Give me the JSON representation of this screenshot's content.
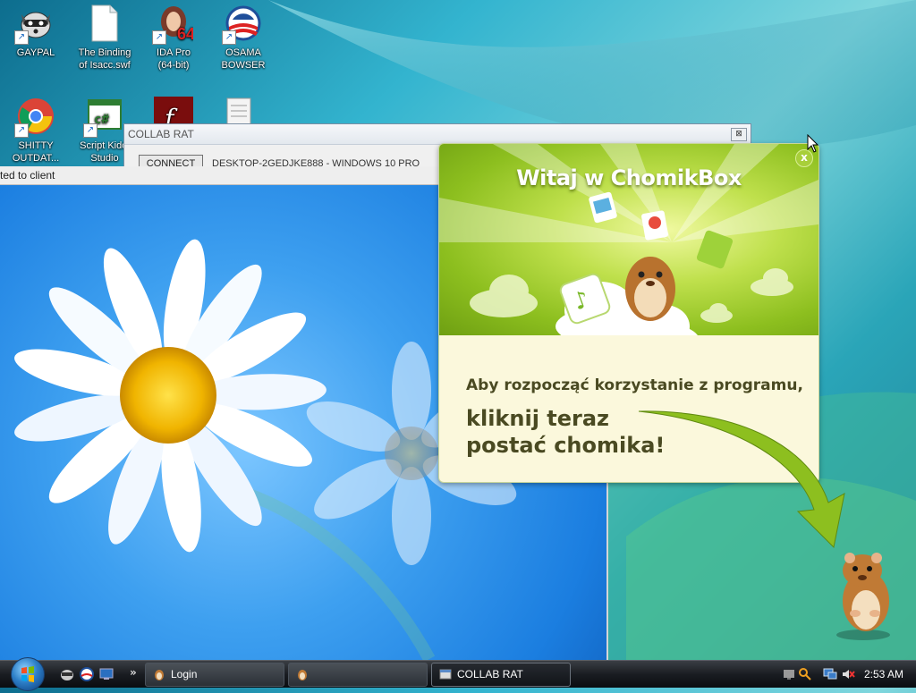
{
  "desktop": {
    "icons": [
      {
        "label_line1": "GAYPAL",
        "label_line2": "",
        "icon": "raccoon-icon"
      },
      {
        "label_line1": "The Binding",
        "label_line2": "of Isacc.swf",
        "icon": "blank-file-icon"
      },
      {
        "label_line1": "IDA Pro",
        "label_line2": "(64-bit)",
        "icon": "ida-pro-icon"
      },
      {
        "label_line1": "OSAMA",
        "label_line2": "BOWSER",
        "icon": "campaign-logo-icon"
      },
      {
        "label_line1": "SHITTY",
        "label_line2": "OUTDAT...",
        "icon": "chrome-icon"
      },
      {
        "label_line1": "Script Kiddi",
        "label_line2": "Studio",
        "icon": "csharp-icon"
      },
      {
        "label_line1": "",
        "label_line2": "",
        "icon": "flash-icon"
      },
      {
        "label_line1": "",
        "label_line2": "",
        "icon": "notebook-icon"
      }
    ]
  },
  "rat_window": {
    "title": "COLLAB RAT",
    "close_glyph": "⊠",
    "connect_label": "CONNECT",
    "info_text": "DESKTOP-2GEDJKE888 - WINDOWS 10 PRO"
  },
  "viewer": {
    "status_text": "ted to client"
  },
  "chomikbox": {
    "title": "Witaj w ChomikBox",
    "close_glyph": "x",
    "line1": "Aby rozpocząć korzystanie z programu,",
    "line2a": "kliknij teraz",
    "line2b": "postać chomika!"
  },
  "taskbar": {
    "quick_launch_chevron": "»",
    "buttons": [
      {
        "label": "Login",
        "icon": "hamster-icon",
        "active": false
      },
      {
        "label": "",
        "icon": "hamster-icon",
        "active": false
      },
      {
        "label": "COLLAB RAT",
        "icon": "window-app-icon",
        "active": true
      }
    ],
    "clock": "2:53 AM"
  },
  "colors": {
    "chomik_green": "#8dbf1f",
    "chomik_text": "#4a4a22",
    "taskbar_dark": "#1a1d22"
  }
}
